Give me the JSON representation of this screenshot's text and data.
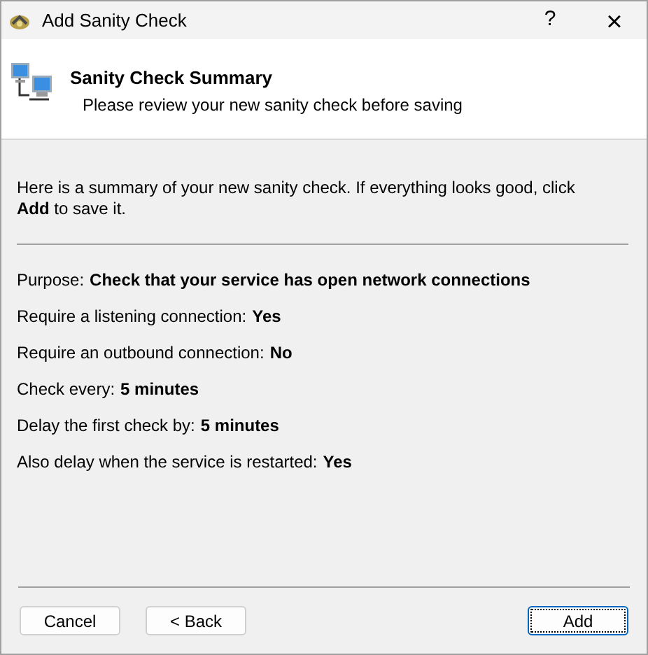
{
  "window": {
    "title": "Add Sanity Check",
    "help": "?",
    "close": "×"
  },
  "header": {
    "title": "Sanity Check Summary",
    "subtitle": "Please review your new sanity check before saving"
  },
  "intro": "Here is a summary of your new sanity check. If everything looks good, click **Add** to save it.",
  "summary": [
    {
      "label": "Purpose:",
      "value": "Check that your service has open network connections"
    },
    {
      "label": "Require a listening connection:",
      "value": "Yes"
    },
    {
      "label": "Require an outbound connection:",
      "value": "No"
    },
    {
      "label": "Check every:",
      "value": "5 minutes"
    },
    {
      "label": "Delay the first check by:",
      "value": "5 minutes"
    },
    {
      "label": "Also delay when the service is restarted:",
      "value": "Yes"
    }
  ],
  "buttons": [
    {
      "label": "Cancel",
      "focused": false
    },
    {
      "label": "< Back",
      "focused": false
    },
    {
      "label": "Add",
      "focused": true
    }
  ]
}
